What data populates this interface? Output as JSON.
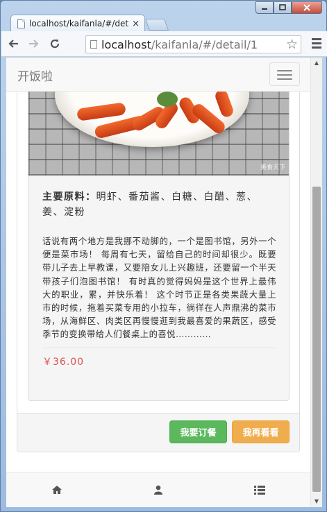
{
  "browser": {
    "tab_title": "localhost/kaifanla/#/det",
    "tab_close": "×",
    "url_host": "localhost",
    "url_path": "/kaifanla/#/detail/1",
    "star_icon": "star-outline-icon"
  },
  "app": {
    "brand": "开饭啦"
  },
  "dish": {
    "photo_watermark": "美食天下",
    "ingredients_label": "主要原料：",
    "ingredients": "明虾、番茄酱、白糖、白醋、葱、姜、淀粉",
    "description": "话说有两个地方是我挪不动脚的，一个是图书馆，另外一个便是菜市场！ 每周有七天，留给自己的时间却很少。既要带儿子去上早教课，又要陪女儿上兴趣班，还要留一个半天带孩子们泡图书馆！ 有时真的觉得妈妈是这个世界上最伟大的职业，累，并快乐着！ 这个时节正是各类果蔬大量上市的时候，拖着买菜专用的小拉车，徜徉在人声鼎沸的菜市场，从海鲜区、肉类区再慢慢逛到我最喜爱的果蔬区，感受季节的变换带给人们餐桌上的喜悦…………",
    "price": "￥36.00"
  },
  "actions": {
    "order_label": "我要订餐",
    "look_label": "我再看看"
  },
  "bottom_nav": {
    "items": [
      {
        "icon": "home-icon"
      },
      {
        "icon": "user-icon"
      },
      {
        "icon": "list-icon"
      }
    ]
  },
  "colors": {
    "price": "#d9534f",
    "order_button": "#5cb85c",
    "look_button": "#f0ad4e"
  }
}
